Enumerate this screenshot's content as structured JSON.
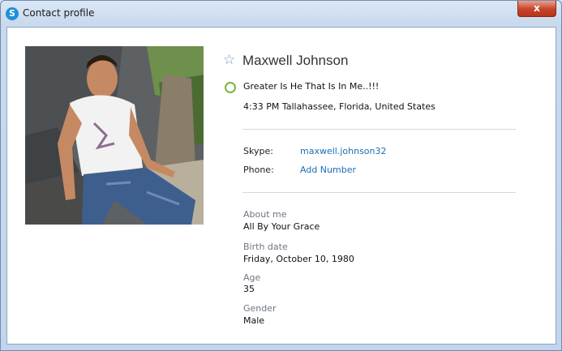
{
  "window": {
    "title": "Contact profile",
    "close_label": "x"
  },
  "profile": {
    "name": "Maxwell Johnson",
    "mood": "Greater Is He That Is In Me..!!!",
    "location": "4:33 PM Tallahassee, Florida, United States"
  },
  "contact": {
    "skype_label": "Skype:",
    "skype_value": "maxwell.johnson32",
    "phone_label": "Phone:",
    "phone_value": "Add Number"
  },
  "details": {
    "about_label": "About me",
    "about_value": "All By Your Grace",
    "birth_label": "Birth date",
    "birth_value": "Friday, October 10, 1980",
    "age_label": "Age",
    "age_value": "35",
    "gender_label": "Gender",
    "gender_value": "Male"
  },
  "colors": {
    "link": "#1a6fb5",
    "status_online": "#7cb342",
    "close_button": "#c7432a"
  },
  "icons": {
    "app": "skype-icon",
    "favorite": "star-outline-icon",
    "status": "status-circle-icon"
  }
}
